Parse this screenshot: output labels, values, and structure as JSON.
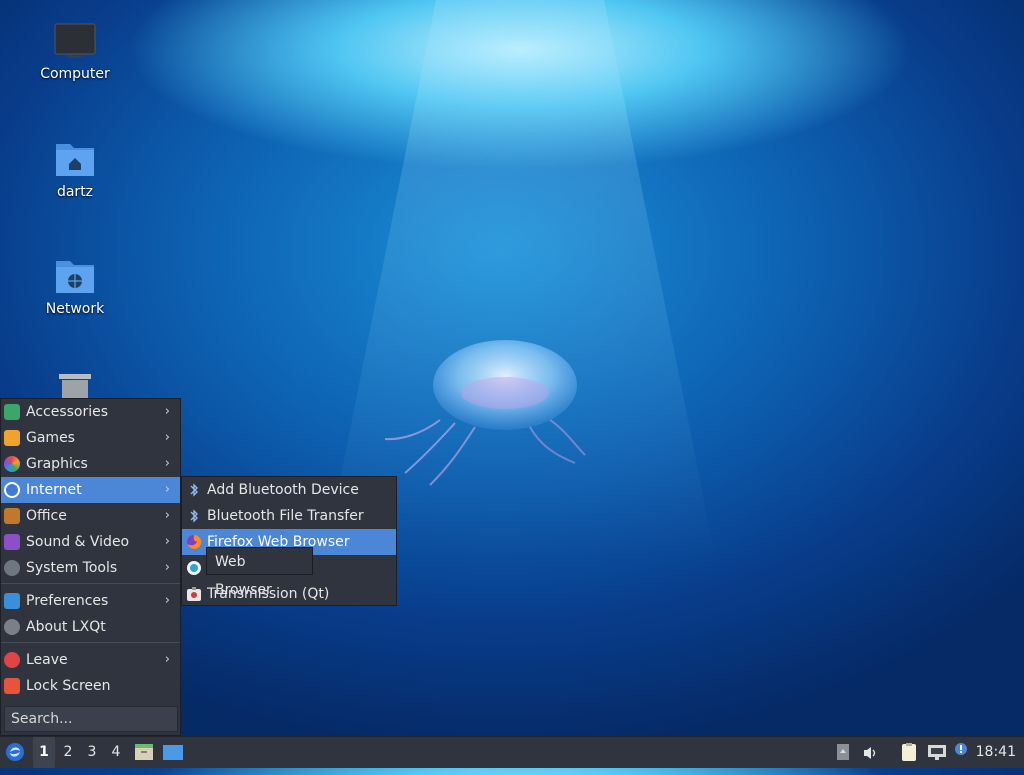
{
  "desktop": {
    "icons": [
      {
        "label": "Computer",
        "icon": "monitor-icon"
      },
      {
        "label": "dartz",
        "icon": "home-folder-icon"
      },
      {
        "label": "Network",
        "icon": "network-folder-icon"
      },
      {
        "label": "",
        "icon": "trash-icon"
      }
    ]
  },
  "menu": {
    "items": [
      {
        "label": "Accessories",
        "icon": "accessories-icon",
        "color": "#3aa66a"
      },
      {
        "label": "Games",
        "icon": "games-icon",
        "color": "#f0a22e"
      },
      {
        "label": "Graphics",
        "icon": "graphics-icon",
        "color": "#d94a7a"
      },
      {
        "label": "Internet",
        "icon": "internet-icon",
        "color": "#3f7ad6"
      },
      {
        "label": "Office",
        "icon": "office-icon",
        "color": "#c0782c"
      },
      {
        "label": "Sound & Video",
        "icon": "multimedia-icon",
        "color": "#8c4fc8"
      },
      {
        "label": "System Tools",
        "icon": "system-tools-icon",
        "color": "#6f7680"
      },
      {
        "label": "Preferences",
        "icon": "preferences-icon",
        "color": "#3a8fd8"
      },
      {
        "label": "About LXQt",
        "icon": "info-icon",
        "color": "#7a7f88"
      },
      {
        "label": "Leave",
        "icon": "power-icon",
        "color": "#e04545"
      },
      {
        "label": "Lock Screen",
        "icon": "lock-icon",
        "color": "#e8533a"
      }
    ],
    "arrow": "›",
    "search_placeholder": "Search..."
  },
  "submenu": {
    "items": [
      {
        "label": "Add Bluetooth Device",
        "icon": "bluetooth-icon"
      },
      {
        "label": "Bluetooth File Transfer",
        "icon": "bluetooth-icon"
      },
      {
        "label": "Firefox Web Browser",
        "icon": "firefox-icon"
      },
      {
        "label": "",
        "icon": "web-browser-icon"
      },
      {
        "label": "Transmission (Qt)",
        "icon": "transmission-icon"
      }
    ]
  },
  "tooltip": {
    "text": "Web Browser"
  },
  "taskbar": {
    "desktops": [
      "1",
      "2",
      "3",
      "4"
    ],
    "clock": "18:41"
  },
  "colors": {
    "accent": "#4b87d6",
    "panel": "#2f343f"
  }
}
